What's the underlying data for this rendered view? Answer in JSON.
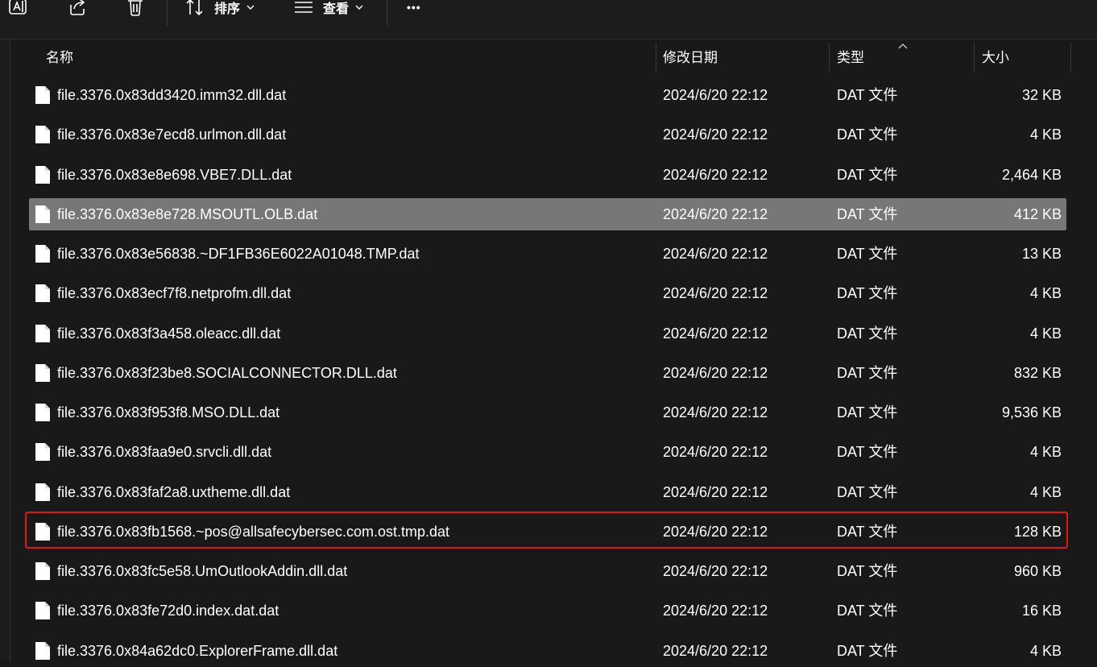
{
  "toolbar": {
    "sort_label": "排序",
    "view_label": "查看",
    "more_label": "•••"
  },
  "columns": {
    "name": "名称",
    "date": "修改日期",
    "type": "类型",
    "size": "大小"
  },
  "selected_row_index": 3,
  "highlighted_row_index": 11,
  "colors": {
    "background": "#191919",
    "selected_row": "#777777",
    "highlight_border": "#e0190f"
  },
  "files": [
    {
      "name": "file.3376.0x83dd3420.imm32.dll.dat",
      "date": "2024/6/20 22:12",
      "type": "DAT 文件",
      "size": "32 KB"
    },
    {
      "name": "file.3376.0x83e7ecd8.urlmon.dll.dat",
      "date": "2024/6/20 22:12",
      "type": "DAT 文件",
      "size": "4 KB"
    },
    {
      "name": "file.3376.0x83e8e698.VBE7.DLL.dat",
      "date": "2024/6/20 22:12",
      "type": "DAT 文件",
      "size": "2,464 KB"
    },
    {
      "name": "file.3376.0x83e8e728.MSOUTL.OLB.dat",
      "date": "2024/6/20 22:12",
      "type": "DAT 文件",
      "size": "412 KB"
    },
    {
      "name": "file.3376.0x83e56838.~DF1FB36E6022A01048.TMP.dat",
      "date": "2024/6/20 22:12",
      "type": "DAT 文件",
      "size": "13 KB"
    },
    {
      "name": "file.3376.0x83ecf7f8.netprofm.dll.dat",
      "date": "2024/6/20 22:12",
      "type": "DAT 文件",
      "size": "4 KB"
    },
    {
      "name": "file.3376.0x83f3a458.oleacc.dll.dat",
      "date": "2024/6/20 22:12",
      "type": "DAT 文件",
      "size": "4 KB"
    },
    {
      "name": "file.3376.0x83f23be8.SOCIALCONNECTOR.DLL.dat",
      "date": "2024/6/20 22:12",
      "type": "DAT 文件",
      "size": "832 KB"
    },
    {
      "name": "file.3376.0x83f953f8.MSO.DLL.dat",
      "date": "2024/6/20 22:12",
      "type": "DAT 文件",
      "size": "9,536 KB"
    },
    {
      "name": "file.3376.0x83faa9e0.srvcli.dll.dat",
      "date": "2024/6/20 22:12",
      "type": "DAT 文件",
      "size": "4 KB"
    },
    {
      "name": "file.3376.0x83faf2a8.uxtheme.dll.dat",
      "date": "2024/6/20 22:12",
      "type": "DAT 文件",
      "size": "4 KB"
    },
    {
      "name": "file.3376.0x83fb1568.~pos@allsafecybersec.com.ost.tmp.dat",
      "date": "2024/6/20 22:12",
      "type": "DAT 文件",
      "size": "128 KB"
    },
    {
      "name": "file.3376.0x83fc5e58.UmOutlookAddin.dll.dat",
      "date": "2024/6/20 22:12",
      "type": "DAT 文件",
      "size": "960 KB"
    },
    {
      "name": "file.3376.0x83fe72d0.index.dat.dat",
      "date": "2024/6/20 22:12",
      "type": "DAT 文件",
      "size": "16 KB"
    },
    {
      "name": "file.3376.0x84a62dc0.ExplorerFrame.dll.dat",
      "date": "2024/6/20 22:12",
      "type": "DAT 文件",
      "size": "4 KB"
    }
  ]
}
